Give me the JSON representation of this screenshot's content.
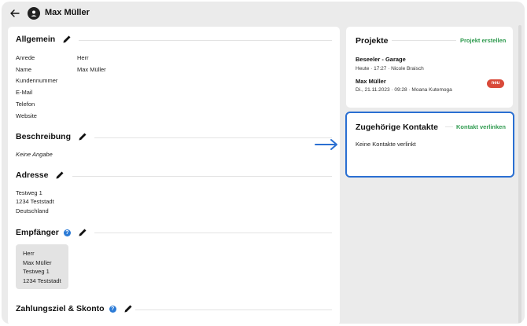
{
  "header": {
    "title": "Max Müller"
  },
  "allgemein": {
    "title": "Allgemein",
    "fields": [
      {
        "label": "Anrede",
        "value": "Herr"
      },
      {
        "label": "Name",
        "value": "Max Müller"
      },
      {
        "label": "Kundennummer",
        "value": ""
      },
      {
        "label": "E-Mail",
        "value": ""
      },
      {
        "label": "Telefon",
        "value": ""
      },
      {
        "label": "Website",
        "value": ""
      }
    ]
  },
  "beschreibung": {
    "title": "Beschreibung",
    "text": "Keine Angabe"
  },
  "adresse": {
    "title": "Adresse",
    "lines": [
      "Testweg 1",
      "1234 Teststadt",
      "Deutschland"
    ]
  },
  "empfaenger": {
    "title": "Empfänger",
    "lines": [
      "Herr",
      "Max Müller",
      "Testweg 1",
      "1234 Teststadt"
    ]
  },
  "zahlungsziel": {
    "title": "Zahlungsziel & Skonto"
  },
  "projekte": {
    "title": "Projekte",
    "action": "Projekt erstellen",
    "items": [
      {
        "title": "Beseeler - Garage",
        "meta": "Heute · 17:27 · Nicole Braisch",
        "badge": ""
      },
      {
        "title": "Max Müller",
        "meta": "Di., 21.11.2023 · 09:28 · Moana Kutemoga",
        "badge": "neu"
      }
    ]
  },
  "kontakte": {
    "title": "Zugehörige Kontakte",
    "action": "Kontakt verlinken",
    "empty": "Keine Kontakte verlinkt"
  },
  "colors": {
    "accent_green": "#2e9a4e",
    "highlight_blue": "#2a6fd2",
    "badge_red": "#d94a3a"
  }
}
